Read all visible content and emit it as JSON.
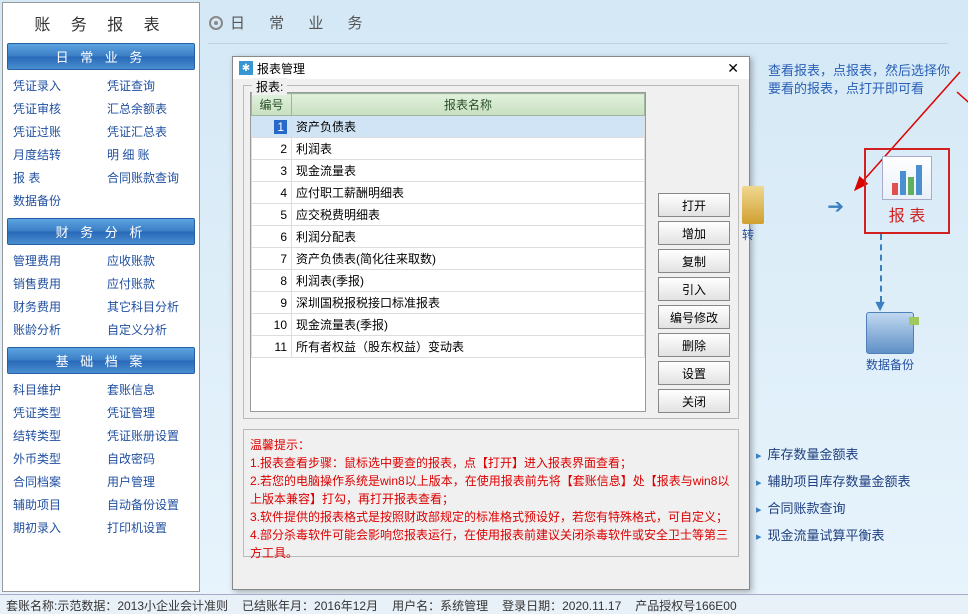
{
  "leftPanel": {
    "title": "账 务 报 表",
    "sections": [
      {
        "header": "日 常 业 务",
        "links": [
          "凭证录入",
          "凭证查询",
          "凭证审核",
          "汇总余额表",
          "凭证过账",
          "凭证汇总表",
          "月度结转",
          "明 细 账",
          "报    表",
          "合同账款查询",
          "数据备份",
          ""
        ]
      },
      {
        "header": "财 务 分 析",
        "links": [
          "管理费用",
          "应收账款",
          "销售费用",
          "应付账款",
          "财务费用",
          "其它科目分析",
          "账龄分析",
          "自定义分析"
        ]
      },
      {
        "header": "基 础 档 案",
        "links": [
          "科目维护",
          "套账信息",
          "凭证类型",
          "凭证管理",
          "结转类型",
          "凭证账册设置",
          "外币类型",
          "自改密码",
          "合同档案",
          "用户管理",
          "辅助项目",
          "自动备份设置",
          "期初录入",
          "打印机设置"
        ]
      }
    ]
  },
  "mainTitle": "日 常 业 务",
  "dialog": {
    "title": "报表管理",
    "fieldset": "报表:",
    "columns": {
      "num": "编号",
      "name": "报表名称"
    },
    "rows": [
      {
        "n": "1",
        "name": "资产负债表"
      },
      {
        "n": "2",
        "name": "利润表"
      },
      {
        "n": "3",
        "name": "现金流量表"
      },
      {
        "n": "4",
        "name": "应付职工薪酬明细表"
      },
      {
        "n": "5",
        "name": "应交税费明细表"
      },
      {
        "n": "6",
        "name": "利润分配表"
      },
      {
        "n": "7",
        "name": "资产负债表(简化往来取数)"
      },
      {
        "n": "8",
        "name": "利润表(季报)"
      },
      {
        "n": "9",
        "name": "深圳国税报税接口标准报表"
      },
      {
        "n": "10",
        "name": "现金流量表(季报)"
      },
      {
        "n": "11",
        "name": "所有者权益（股东权益）变动表"
      }
    ],
    "buttons": [
      "打开",
      "增加",
      "复制",
      "引入",
      "编号修改",
      "删除",
      "设置",
      "关闭"
    ],
    "tipsHead": "温馨提示：",
    "tips": [
      "1.报表查看步骤：鼠标选中要查的报表，点【打开】进入报表界面查看；",
      "2.若您的电脑操作系统是win8以上版本，在使用报表前先将【套账信息】处【报表与win8以上版本兼容】打勾，再打开报表查看；",
      "3.软件提供的报表格式是按照财政部规定的标准格式预设好，若您有特殊格式，可自定义；",
      "4.部分杀毒软件可能会影响您报表运行，在使用报表前建议关闭杀毒软件或安全卫士等第三方工具。"
    ]
  },
  "callout": "查看报表，点报表，然后选择你要看的报表，点打开即可看",
  "iconLabels": {
    "transfer": "转",
    "report": "报  表",
    "backup": "数据备份"
  },
  "quickLinks": [
    "库存数量金额表",
    "辅助项目库存数量金额表",
    "合同账款查询",
    "现金流量试算平衡表"
  ],
  "status": {
    "acct": "套账名称:示范数据：2013小企业会计准则",
    "period": "已结账年月：2016年12月",
    "user": "用户名：系统管理",
    "login": "登录日期：2020.11.17",
    "auth": "产品授权号166E00"
  }
}
